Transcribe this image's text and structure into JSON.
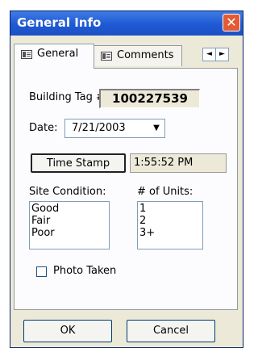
{
  "window": {
    "title": "General Info"
  },
  "tabs": [
    {
      "label": "General",
      "active": true
    },
    {
      "label": "Comments",
      "active": false
    }
  ],
  "tab_scroll": {
    "left": "◄",
    "right": "►"
  },
  "building_tag": {
    "label": "Building Tag #:",
    "value": "100227539"
  },
  "date": {
    "label": "Date:",
    "value": "7/21/2003"
  },
  "timestamp": {
    "button_label": "Time Stamp",
    "value": "1:55:52 PM"
  },
  "site_condition": {
    "label": "Site Condition:",
    "options": [
      "Good",
      "Fair",
      "Poor"
    ]
  },
  "units": {
    "label": "# of Units:",
    "options": [
      "1",
      "2",
      "3+"
    ]
  },
  "photo_taken": {
    "label": "Photo Taken",
    "checked": false
  },
  "footer": {
    "ok_label": "OK",
    "cancel_label": "Cancel"
  }
}
